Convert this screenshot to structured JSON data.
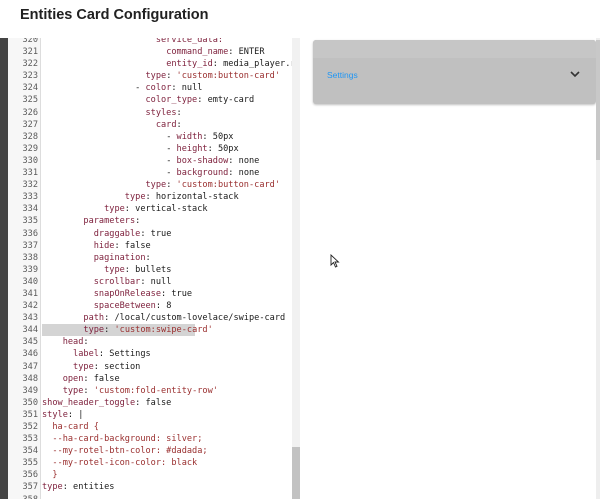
{
  "dialog": {
    "title": "Entities Card Configuration"
  },
  "editor": {
    "lines": [
      {
        "n": "320",
        "indent": 22,
        "segs": [
          [
            "k",
            "service_data:"
          ]
        ]
      },
      {
        "n": "321",
        "indent": 24,
        "segs": [
          [
            "k",
            "command_name"
          ],
          [
            "t",
            ": ENTER"
          ]
        ]
      },
      {
        "n": "322",
        "indent": 24,
        "segs": [
          [
            "k",
            "entity_id"
          ],
          [
            "t",
            ": media_player.rotel_"
          ]
        ]
      },
      {
        "n": "323",
        "indent": 20,
        "segs": [
          [
            "k",
            "type"
          ],
          [
            "t",
            ": "
          ],
          [
            "s",
            "'custom:button-card'"
          ]
        ]
      },
      {
        "n": "324",
        "indent": 18,
        "segs": [
          [
            "t",
            "- "
          ],
          [
            "k",
            "color"
          ],
          [
            "t",
            ": null"
          ]
        ]
      },
      {
        "n": "325",
        "indent": 20,
        "segs": [
          [
            "k",
            "color_type"
          ],
          [
            "t",
            ": emty-card"
          ]
        ]
      },
      {
        "n": "326",
        "indent": 20,
        "segs": [
          [
            "k",
            "styles"
          ],
          [
            "t",
            ":"
          ]
        ]
      },
      {
        "n": "327",
        "indent": 22,
        "segs": [
          [
            "k",
            "card"
          ],
          [
            "t",
            ":"
          ]
        ]
      },
      {
        "n": "328",
        "indent": 24,
        "segs": [
          [
            "t",
            "- "
          ],
          [
            "k",
            "width"
          ],
          [
            "t",
            ": 50px"
          ]
        ]
      },
      {
        "n": "329",
        "indent": 24,
        "segs": [
          [
            "t",
            "- "
          ],
          [
            "k",
            "height"
          ],
          [
            "t",
            ": 50px"
          ]
        ]
      },
      {
        "n": "330",
        "indent": 24,
        "segs": [
          [
            "t",
            "- "
          ],
          [
            "k",
            "box-shadow"
          ],
          [
            "t",
            ": none"
          ]
        ]
      },
      {
        "n": "331",
        "indent": 24,
        "segs": [
          [
            "t",
            "- "
          ],
          [
            "k",
            "background"
          ],
          [
            "t",
            ": none"
          ]
        ]
      },
      {
        "n": "332",
        "indent": 20,
        "segs": [
          [
            "k",
            "type"
          ],
          [
            "t",
            ": "
          ],
          [
            "s",
            "'custom:button-card'"
          ]
        ]
      },
      {
        "n": "333",
        "indent": 16,
        "segs": [
          [
            "k",
            "type"
          ],
          [
            "t",
            ": horizontal-stack"
          ]
        ]
      },
      {
        "n": "334",
        "indent": 12,
        "segs": [
          [
            "k",
            "type"
          ],
          [
            "t",
            ": vertical-stack"
          ]
        ]
      },
      {
        "n": "335",
        "indent": 8,
        "segs": [
          [
            "k",
            "parameters"
          ],
          [
            "t",
            ":"
          ]
        ]
      },
      {
        "n": "336",
        "indent": 10,
        "segs": [
          [
            "k",
            "draggable"
          ],
          [
            "t",
            ": true"
          ]
        ]
      },
      {
        "n": "337",
        "indent": 10,
        "segs": [
          [
            "k",
            "hide"
          ],
          [
            "t",
            ": false"
          ]
        ]
      },
      {
        "n": "338",
        "indent": 10,
        "segs": [
          [
            "k",
            "pagination"
          ],
          [
            "t",
            ":"
          ]
        ]
      },
      {
        "n": "339",
        "indent": 12,
        "segs": [
          [
            "k",
            "type"
          ],
          [
            "t",
            ": bullets"
          ]
        ]
      },
      {
        "n": "340",
        "indent": 10,
        "segs": [
          [
            "k",
            "scrollbar"
          ],
          [
            "t",
            ": null"
          ]
        ]
      },
      {
        "n": "341",
        "indent": 10,
        "segs": [
          [
            "k",
            "snapOnRelease"
          ],
          [
            "t",
            ": true"
          ]
        ]
      },
      {
        "n": "342",
        "indent": 10,
        "segs": [
          [
            "k",
            "spaceBetween"
          ],
          [
            "t",
            ": 8"
          ]
        ]
      },
      {
        "n": "343",
        "indent": 8,
        "segs": [
          [
            "k",
            "path"
          ],
          [
            "t",
            ": /local/custom-lovelace/swipe-card"
          ]
        ]
      },
      {
        "n": "344",
        "indent": 8,
        "active": true,
        "segs": [
          [
            "k",
            "type"
          ],
          [
            "t",
            ": "
          ],
          [
            "s",
            "'custom:swipe-card'"
          ]
        ]
      },
      {
        "n": "345",
        "indent": 4,
        "segs": [
          [
            "k",
            "head"
          ],
          [
            "t",
            ":"
          ]
        ]
      },
      {
        "n": "346",
        "indent": 6,
        "segs": [
          [
            "k",
            "label"
          ],
          [
            "t",
            ": Settings"
          ]
        ]
      },
      {
        "n": "347",
        "indent": 6,
        "segs": [
          [
            "k",
            "type"
          ],
          [
            "t",
            ": section"
          ]
        ]
      },
      {
        "n": "348",
        "indent": 4,
        "segs": [
          [
            "k",
            "open"
          ],
          [
            "t",
            ": false"
          ]
        ]
      },
      {
        "n": "349",
        "indent": 4,
        "segs": [
          [
            "k",
            "type"
          ],
          [
            "t",
            ": "
          ],
          [
            "s",
            "'custom:fold-entity-row'"
          ]
        ]
      },
      {
        "n": "350",
        "indent": 0,
        "segs": [
          [
            "k",
            "show_header_toggle"
          ],
          [
            "t",
            ": false"
          ]
        ]
      },
      {
        "n": "351",
        "indent": 0,
        "segs": [
          [
            "k",
            "style"
          ],
          [
            "t",
            ": |"
          ]
        ]
      },
      {
        "n": "352",
        "indent": 2,
        "segs": [
          [
            "s",
            "ha-card {"
          ]
        ]
      },
      {
        "n": "353",
        "indent": 2,
        "segs": [
          [
            "s",
            "--ha-card-background: silver;"
          ]
        ]
      },
      {
        "n": "354",
        "indent": 2,
        "segs": [
          [
            "s",
            "--my-rotel-btn-color: #dadada;"
          ]
        ]
      },
      {
        "n": "355",
        "indent": 2,
        "segs": [
          [
            "s",
            "--my-rotel-icon-color: black"
          ]
        ]
      },
      {
        "n": "356",
        "indent": 2,
        "segs": [
          [
            "s",
            "}"
          ]
        ]
      },
      {
        "n": "357",
        "indent": 0,
        "segs": [
          [
            "k",
            "type"
          ],
          [
            "t",
            ": entities"
          ]
        ]
      },
      {
        "n": "358",
        "indent": 0,
        "segs": []
      }
    ]
  },
  "preview": {
    "row_label": "Settings",
    "chevron_icon": "chevron-down-icon",
    "card_background": "#c0c0c0",
    "label_color": "#2196f3"
  }
}
